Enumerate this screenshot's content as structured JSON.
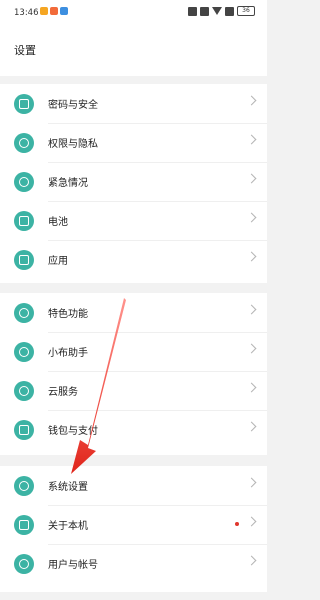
{
  "status_bar": {
    "time": "13:46",
    "battery": "36"
  },
  "header": {
    "title": "设置"
  },
  "groups": [
    [
      {
        "label": "密码与安全",
        "icon": "lock-icon"
      },
      {
        "label": "权限与隐私",
        "icon": "eye-icon"
      },
      {
        "label": "紧急情况",
        "icon": "sos-icon"
      },
      {
        "label": "电池",
        "icon": "battery-icon"
      },
      {
        "label": "应用",
        "icon": "apps-icon"
      }
    ],
    [
      {
        "label": "特色功能",
        "icon": "star-icon"
      },
      {
        "label": "小布助手",
        "icon": "assistant-icon"
      },
      {
        "label": "云服务",
        "icon": "cloud-icon"
      },
      {
        "label": "钱包与支付",
        "icon": "wallet-icon"
      }
    ],
    [
      {
        "label": "系统设置",
        "icon": "system-icon"
      },
      {
        "label": "关于本机",
        "icon": "phone-icon",
        "badge": true
      },
      {
        "label": "用户与帐号",
        "icon": "user-icon"
      }
    ]
  ],
  "colors": {
    "accent": "#3cb3a4",
    "annotation_arrow": "#e0251b",
    "badge": "#e0362d"
  }
}
